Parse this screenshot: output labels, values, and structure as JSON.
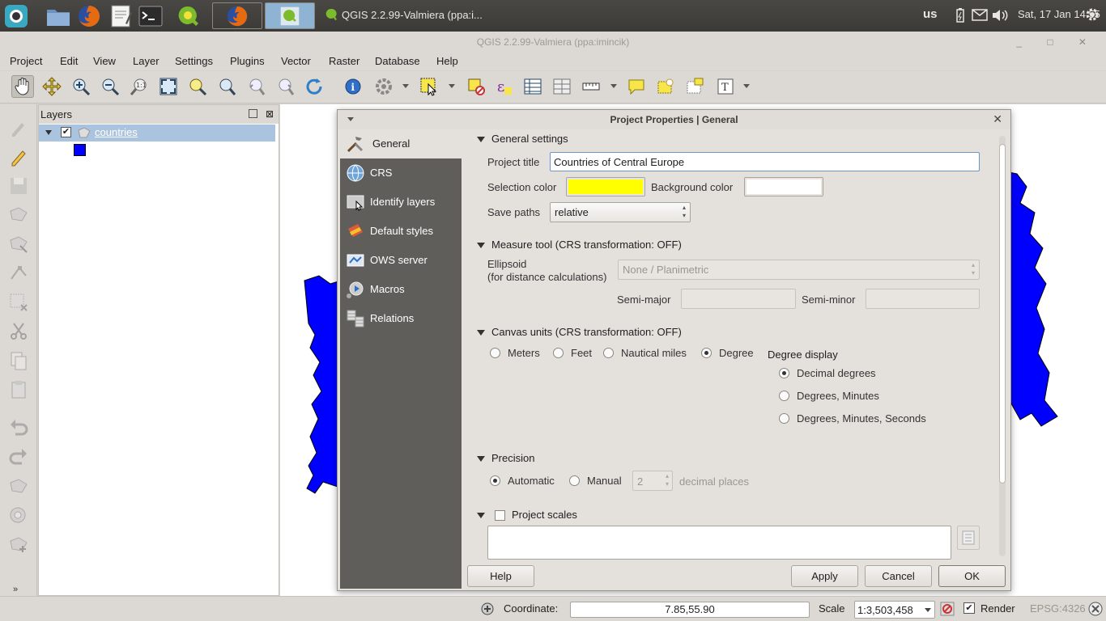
{
  "panel": {
    "window_task_title": "QGIS 2.2.99-Valmiera (ppa:i...",
    "keyboard_layout": "us",
    "clock": "Sat, 17 Jan  14:55"
  },
  "window": {
    "title": "QGIS 2.2.99-Valmiera (ppa:imincik)"
  },
  "menus": [
    "Project",
    "Edit",
    "View",
    "Layer",
    "Settings",
    "Plugins",
    "Vector",
    "Raster",
    "Database",
    "Help"
  ],
  "layers_panel": {
    "title": "Layers",
    "layer_name": "countries",
    "layer_color": "#0000ff"
  },
  "dialog": {
    "title": "Project Properties | General",
    "nav": [
      "General",
      "CRS",
      "Identify layers",
      "Default styles",
      "OWS server",
      "Macros",
      "Relations"
    ],
    "general_settings": {
      "header": "General settings",
      "project_title_label": "Project title",
      "project_title_value": "Countries of Central Europe",
      "selection_color_label": "Selection color",
      "selection_color": "#ffff00",
      "background_color_label": "Background color",
      "background_color": "#ffffff",
      "save_paths_label": "Save paths",
      "save_paths_value": "relative"
    },
    "measure_tool": {
      "header": "Measure tool (CRS transformation: OFF)",
      "ellipsoid_label_1": "Ellipsoid",
      "ellipsoid_label_2": "(for distance calculations)",
      "ellipsoid_value": "None / Planimetric",
      "semi_major_label": "Semi-major",
      "semi_minor_label": "Semi-minor"
    },
    "canvas_units": {
      "header": "Canvas units (CRS transformation: OFF)",
      "meters": "Meters",
      "feet": "Feet",
      "nautical": "Nautical miles",
      "degree": "Degree",
      "degree_display_label": "Degree display",
      "decimal": "Decimal degrees",
      "deg_min": "Degrees, Minutes",
      "deg_min_sec": "Degrees, Minutes, Seconds"
    },
    "precision": {
      "header": "Precision",
      "automatic": "Automatic",
      "manual": "Manual",
      "places_value": "2",
      "places_label": "decimal places"
    },
    "project_scales": {
      "header": "Project scales"
    },
    "buttons": {
      "help": "Help",
      "apply": "Apply",
      "cancel": "Cancel",
      "ok": "OK"
    }
  },
  "statusbar": {
    "coordinate_label": "Coordinate:",
    "coordinate_value": "7.85,55.90",
    "scale_label": "Scale",
    "scale_value": "1:3,503,458",
    "render_label": "Render",
    "crs": "EPSG:4326"
  }
}
